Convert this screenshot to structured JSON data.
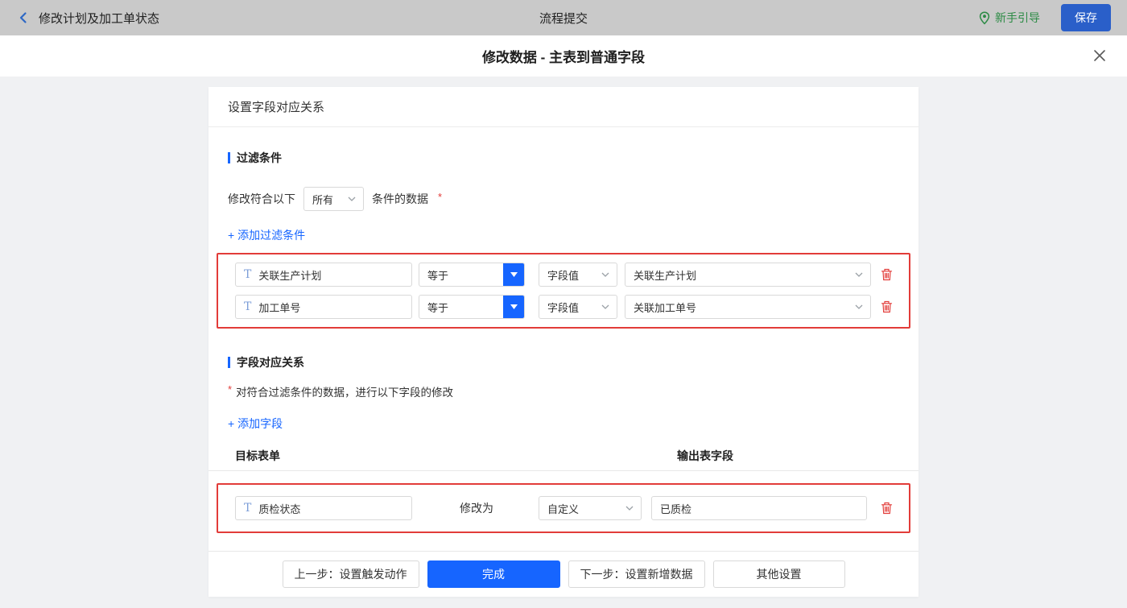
{
  "colors": {
    "accent_blue": "#1665ff",
    "danger_red": "#e23c39",
    "guide_green": "#2b8a44",
    "save_blue": "#2a5fc9",
    "topbar_gray": "#c9c9c9"
  },
  "topbar": {
    "back_title": "修改计划及加工单状态",
    "center_title": "流程提交",
    "guide_label": "新手引导",
    "save_label": "保存"
  },
  "dialog": {
    "title": "修改数据 - 主表到普通字段",
    "panel_title": "设置字段对应关系",
    "filter_section": {
      "title": "过滤条件",
      "prefix_label": "修改符合以下",
      "condition_value": "所有",
      "suffix_label": "条件的数据",
      "required_mark": "*",
      "add_link": "+ 添加过滤条件",
      "rows": [
        {
          "field": "关联生产计划",
          "operator": "等于",
          "value_type": "字段值",
          "value": "关联生产计划"
        },
        {
          "field": "加工单号",
          "operator": "等于",
          "value_type": "字段值",
          "value": "关联加工单号"
        }
      ]
    },
    "mapping_section": {
      "title": "字段对应关系",
      "required_mark": "*",
      "description": "对符合过滤条件的数据，进行以下字段的修改",
      "add_link": "+ 添加字段",
      "column_target": "目标表单",
      "column_output": "输出表字段",
      "rows": [
        {
          "field": "质检状态",
          "action_label": "修改为",
          "value_type": "自定义",
          "value": "已质检"
        }
      ]
    },
    "footer": {
      "prev_label": "上一步：设置触发动作",
      "done_label": "完成",
      "next_label": "下一步：设置新增数据",
      "other_label": "其他设置"
    }
  }
}
